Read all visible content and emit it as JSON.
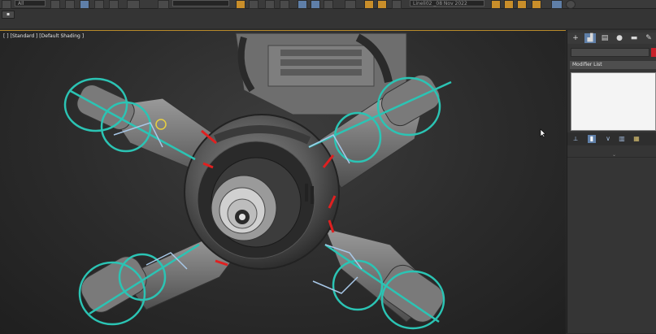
{
  "toolbar": {
    "selection_filter": "All",
    "named_selection": "Lineli02 _08 Nov 2022",
    "icons": [
      "undo-icon",
      "redo-icon",
      "link-icon",
      "select-icon",
      "move-icon",
      "rotate-icon",
      "scale-icon",
      "percent-snap-icon",
      "mirror-icon",
      "layer-icon",
      "schematic-icon",
      "material-icon",
      "render-setup-icon",
      "render-icon"
    ]
  },
  "viewport": {
    "label": "[ ] [Standard ] [Default Shading ]",
    "accent_color": "#b88a2a",
    "rig_color": "#2bc4b4",
    "seam_color": "#e02020"
  },
  "command_panel": {
    "tabs": [
      "+",
      "modify",
      "hierarchy",
      "motion",
      "display",
      "utilities"
    ],
    "name_value": "",
    "swatch_color": "#c8202a",
    "modifier_list_label": "Modifier List",
    "stack_tools": [
      "pin-stack-icon",
      "show-end-result-icon",
      "make-unique-icon",
      "remove-modifier-icon",
      "configure-sets-icon"
    ]
  }
}
